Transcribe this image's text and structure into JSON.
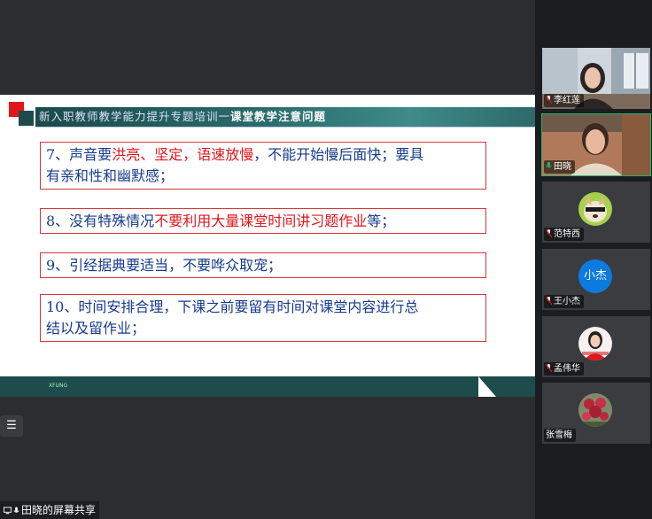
{
  "slide": {
    "title_part1": "新入职教师教学能力提升专题培训一",
    "title_part2": "课堂教学注意问题",
    "footer_text": "XFUNG",
    "rules": [
      {
        "id": "rule7",
        "line1_a": "7、声音要",
        "line1_hl": "洪亮、坚定，语速放慢",
        "line1_b": "，不能开始慢后面快；要具",
        "line2": "有亲和性和幽默感；"
      },
      {
        "id": "rule8",
        "a": "8、没有特殊情况",
        "hl": "不要利用大量课堂时间讲习题作业",
        "b": "等；"
      },
      {
        "id": "rule9",
        "text": "9、引经据典要适当，不要哗众取宠；"
      },
      {
        "id": "rule10",
        "line1": "10、时间安排合理，下课之前要留有时间对课堂内容进行总",
        "line2": "结以及留作业；"
      }
    ]
  },
  "share": {
    "label": "田晓的屏幕共享"
  },
  "toolbar": {
    "list_icon": "list-icon"
  },
  "participants": [
    {
      "name": "李红莲",
      "muted": true,
      "kind": "video"
    },
    {
      "name": "田晓",
      "muted": false,
      "kind": "video",
      "active": true
    },
    {
      "name": "范特西",
      "muted": true,
      "kind": "avatar-image"
    },
    {
      "name": "王小杰",
      "muted": true,
      "kind": "avatar-text",
      "avatar_text": "小杰"
    },
    {
      "name": "孟伟华",
      "muted": true,
      "kind": "avatar-image"
    },
    {
      "name": "张雪梅",
      "muted": false,
      "kind": "avatar-image"
    }
  ],
  "colors": {
    "accent_red": "#e0161c",
    "text_blue": "#163b8c",
    "slide_teal": "#1e4b4b",
    "active_green": "#1fb86e",
    "avatar_blue": "#0c7be0"
  }
}
